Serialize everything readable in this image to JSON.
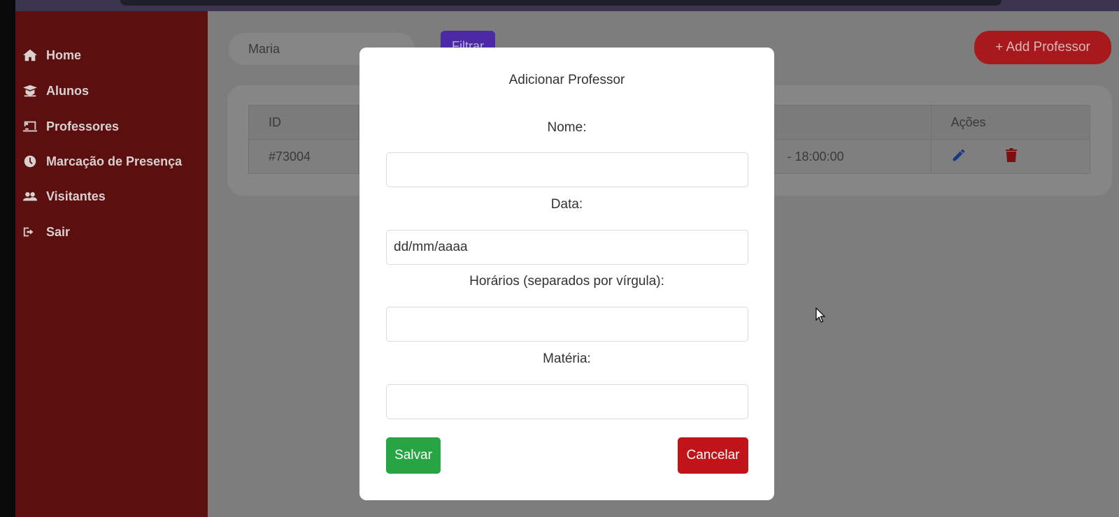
{
  "sidebar": {
    "items": [
      {
        "label": "Home",
        "icon": "home-icon"
      },
      {
        "label": "Alunos",
        "icon": "graduation-icon"
      },
      {
        "label": "Professores",
        "icon": "chalkboard-icon"
      },
      {
        "label": "Marcação de Presença",
        "icon": "clock-icon"
      },
      {
        "label": "Visitantes",
        "icon": "users-icon"
      },
      {
        "label": "Sair",
        "icon": "sign-out-icon"
      }
    ]
  },
  "toolbar": {
    "search_value": "Maria",
    "filter_label": "Filtrar",
    "add_label": "+ Add Professor"
  },
  "table": {
    "headers": {
      "id": "ID",
      "actions": "Ações"
    },
    "rows": [
      {
        "id": "#73004",
        "time": "- 18:00:00"
      }
    ]
  },
  "modal": {
    "title": "Adicionar Professor",
    "fields": [
      {
        "label": "Nome:",
        "value": "",
        "placeholder": ""
      },
      {
        "label": "Data:",
        "value": "",
        "placeholder": "dd/mm/aaaa"
      },
      {
        "label": "Horários (separados por vírgula):",
        "value": "",
        "placeholder": ""
      },
      {
        "label": "Matéria:",
        "value": "",
        "placeholder": ""
      }
    ],
    "save_label": "Salvar",
    "cancel_label": "Cancelar"
  },
  "colors": {
    "sidebar": "#5b0f0f",
    "save": "#27a444",
    "cancel": "#c0141a",
    "add": "#a8191d",
    "filter": "#4c2aa5"
  }
}
